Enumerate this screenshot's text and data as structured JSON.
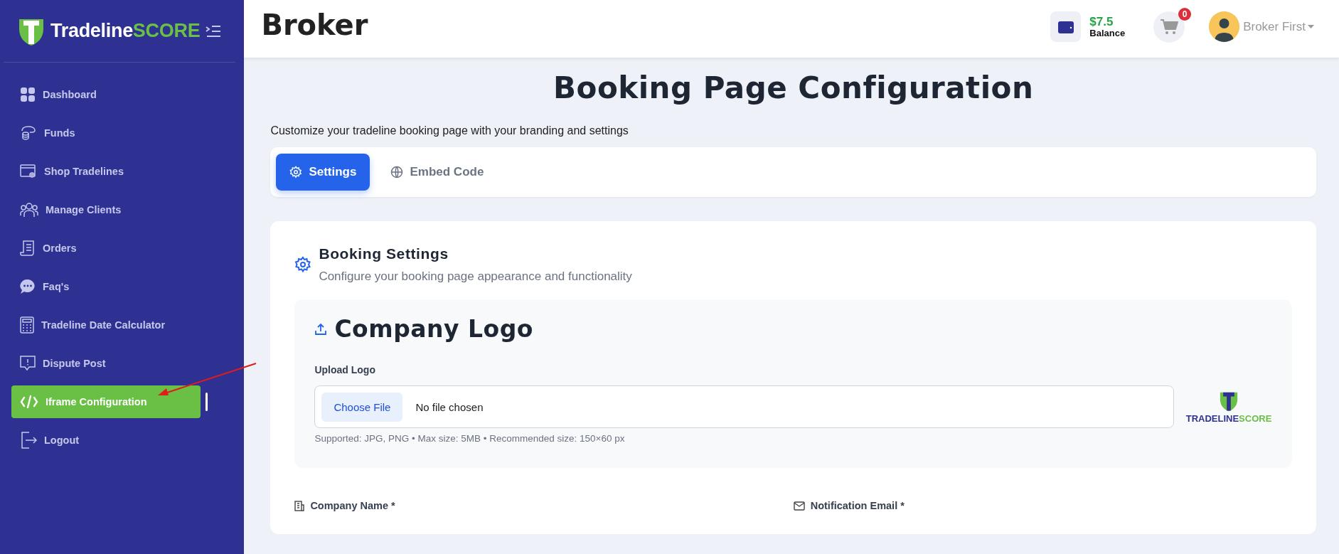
{
  "sidebar": {
    "brand": {
      "part_1": "Tradeline",
      "part_2": "SCORE"
    },
    "items": [
      {
        "label": "Dashboard",
        "selected": false
      },
      {
        "label": "Funds",
        "selected": false
      },
      {
        "label": "Shop Tradelines",
        "selected": false
      },
      {
        "label": "Manage Clients",
        "selected": false
      },
      {
        "label": "Orders",
        "selected": false
      },
      {
        "label": "Faq's",
        "selected": false
      },
      {
        "label": "Tradeline Date Calculator",
        "selected": false
      },
      {
        "label": "Dispute Post",
        "selected": false
      },
      {
        "label": "Iframe Configuration",
        "selected": true
      },
      {
        "label": "Logout",
        "selected": false
      }
    ]
  },
  "header": {
    "title": "Broker",
    "balance_amount": "$7.5",
    "balance_label": "Balance",
    "cart_count": "0",
    "user_name": "Broker First"
  },
  "page": {
    "title": "Booking Page Configuration",
    "subtitle": "Customize your tradeline booking page with your branding and settings",
    "tabs": [
      {
        "label": "Settings",
        "selected": true
      },
      {
        "label": "Embed Code",
        "selected": false
      }
    ],
    "section": {
      "title": "Booking Settings",
      "description": "Configure your booking page appearance and functionality",
      "logo_panel": {
        "title": "Company Logo",
        "field_label": "Upload Logo",
        "button": "Choose File",
        "file_status": "No file chosen",
        "help": "Supported: JPG, PNG • Max size: 5MB • Recommended size: 150×60 px",
        "preview": {
          "part_1": "TRADELINE",
          "part_2": "SCORE"
        }
      },
      "fields": [
        {
          "label": "Company Name *"
        },
        {
          "label": "Notification Email *"
        }
      ]
    }
  }
}
